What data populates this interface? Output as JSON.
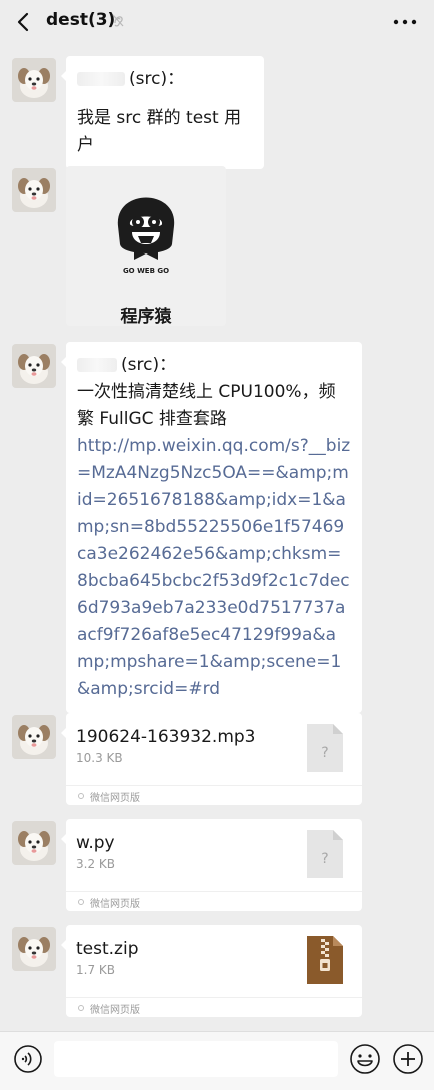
{
  "header": {
    "back_icon": "back-arrow-icon",
    "title": "dest(3)",
    "mute_icon": "ear-muted-icon",
    "more_icon": "ellipsis-icon"
  },
  "messages": [
    {
      "type": "text",
      "sender_suffix": "(src)：",
      "body": "我是 src 群的 test 用户"
    },
    {
      "type": "sticker",
      "badge_text": "GO WEB GO",
      "caption": "程序猿"
    },
    {
      "type": "text_link",
      "sender_suffix": "(src)：",
      "body": "一次性搞清楚线上 CPU100%，频繁 FullGC 排查套路",
      "link": "http://mp.weixin.qq.com/s?__biz=MzA4Nzg5Nzc5OA==&amp;mid=2651678188&amp;idx=1&amp;sn=8bd55225506e1f57469ca3e262462e56&amp;chksm=8bcba645bcbc2f53d9f2c1c7dec6d793a9eb7a233e0d7517737aacf9f726af8e5ec47129f99a&amp;mpshare=1&amp;scene=1&amp;srcid=#rd"
    },
    {
      "type": "file",
      "name": "190624-163932.mp3",
      "size": "10.3 KB",
      "source": "微信网页版",
      "icon": "unknown-file-icon"
    },
    {
      "type": "file",
      "name": "w.py",
      "size": "3.2 KB",
      "source": "微信网页版",
      "icon": "unknown-file-icon"
    },
    {
      "type": "file",
      "name": "test.zip",
      "size": "1.7 KB",
      "source": "微信网页版",
      "icon": "zip-file-icon"
    }
  ],
  "input_bar": {
    "voice_icon": "voice-input-icon",
    "input_value": "",
    "emoji_icon": "emoji-icon",
    "plus_icon": "plus-icon"
  },
  "colors": {
    "background": "#ededed",
    "bubble": "#ffffff",
    "link": "#576b95",
    "muted_text": "#9a9a9a",
    "zip_brown": "#8a5a2b"
  }
}
